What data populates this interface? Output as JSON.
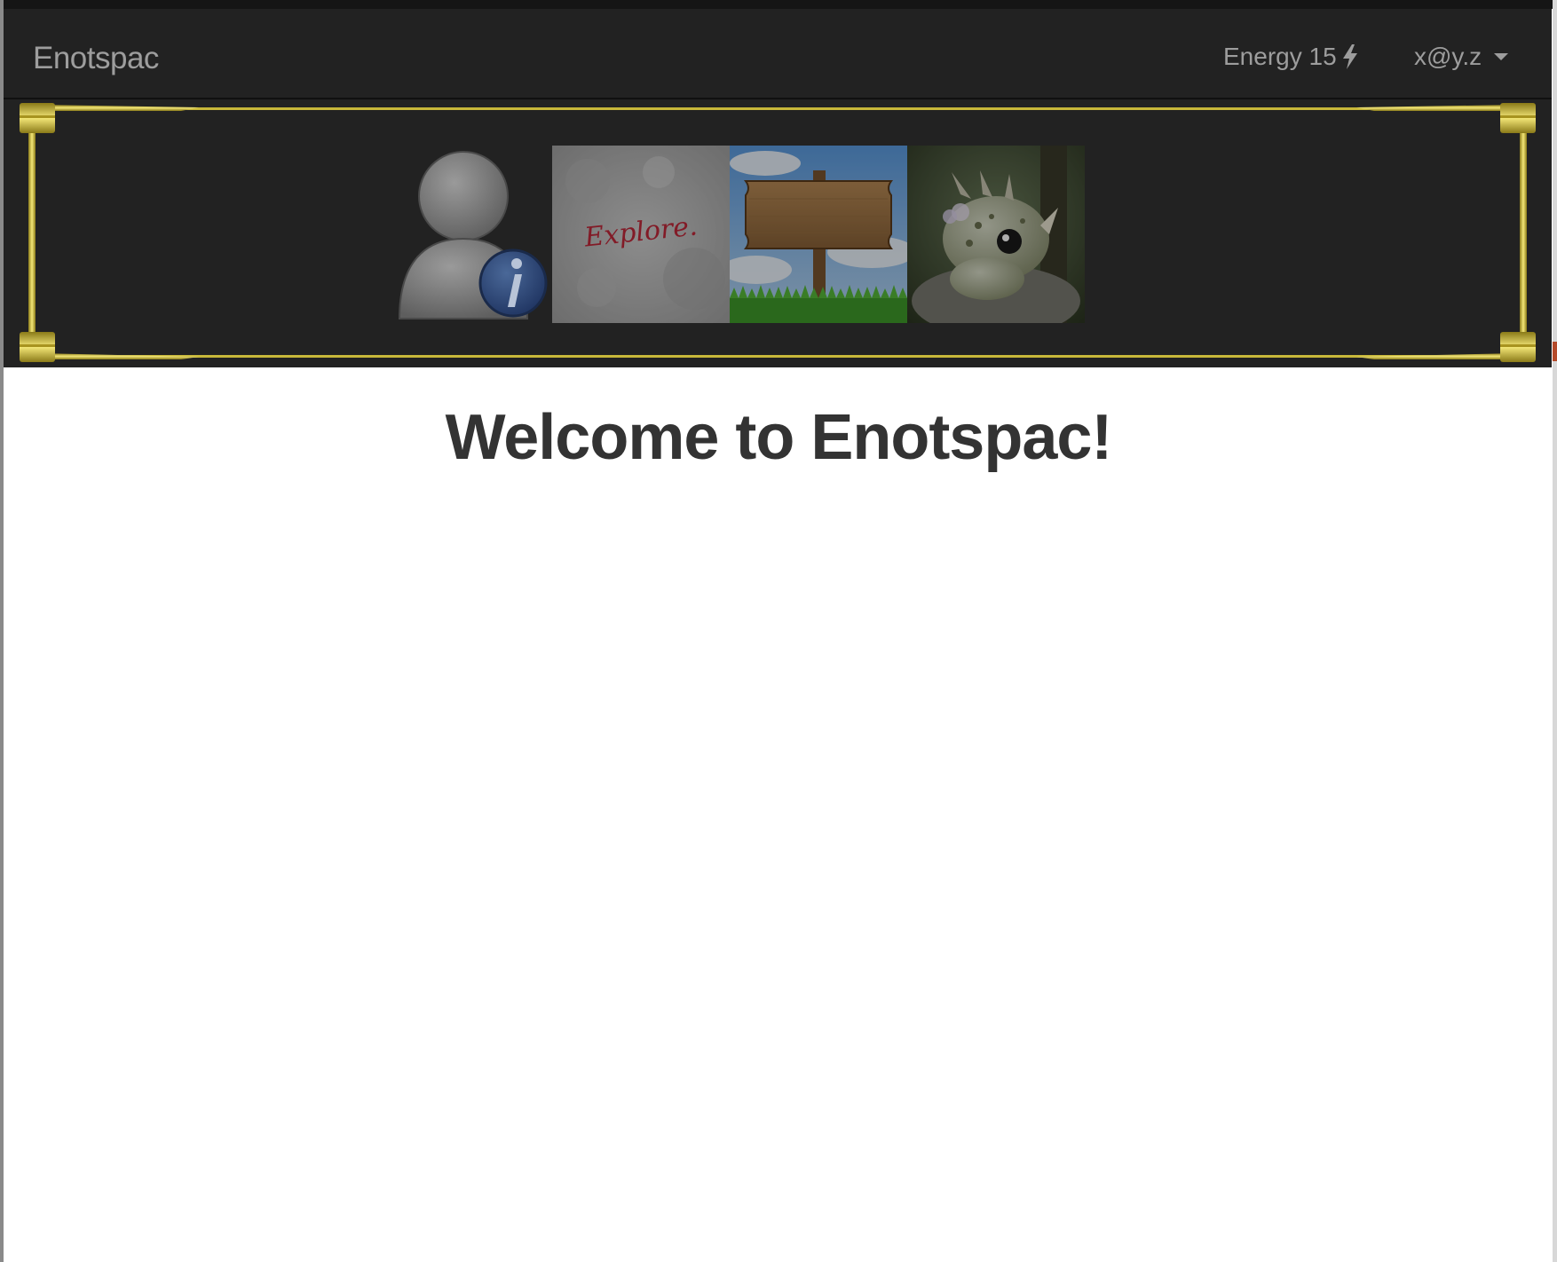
{
  "navbar": {
    "brand": "Enotspac",
    "energy_label": "Energy 15",
    "energy_icon": "lightning-bolt-icon",
    "user_email": "x@y.z",
    "user_menu_icon": "caret-down-icon"
  },
  "banner": {
    "tiles": [
      {
        "name": "profile-info",
        "icon": "user-info-icon"
      },
      {
        "name": "explore",
        "text": "Explore."
      },
      {
        "name": "signpost",
        "icon": "wooden-signpost"
      },
      {
        "name": "creature",
        "icon": "horned-creature"
      }
    ],
    "frame_color": "#e8d44a"
  },
  "main": {
    "heading": "Welcome to Enotspac!"
  },
  "colors": {
    "navbar_bg": "#222222",
    "nav_text": "#9d9d9d",
    "heading_text": "#333333"
  }
}
